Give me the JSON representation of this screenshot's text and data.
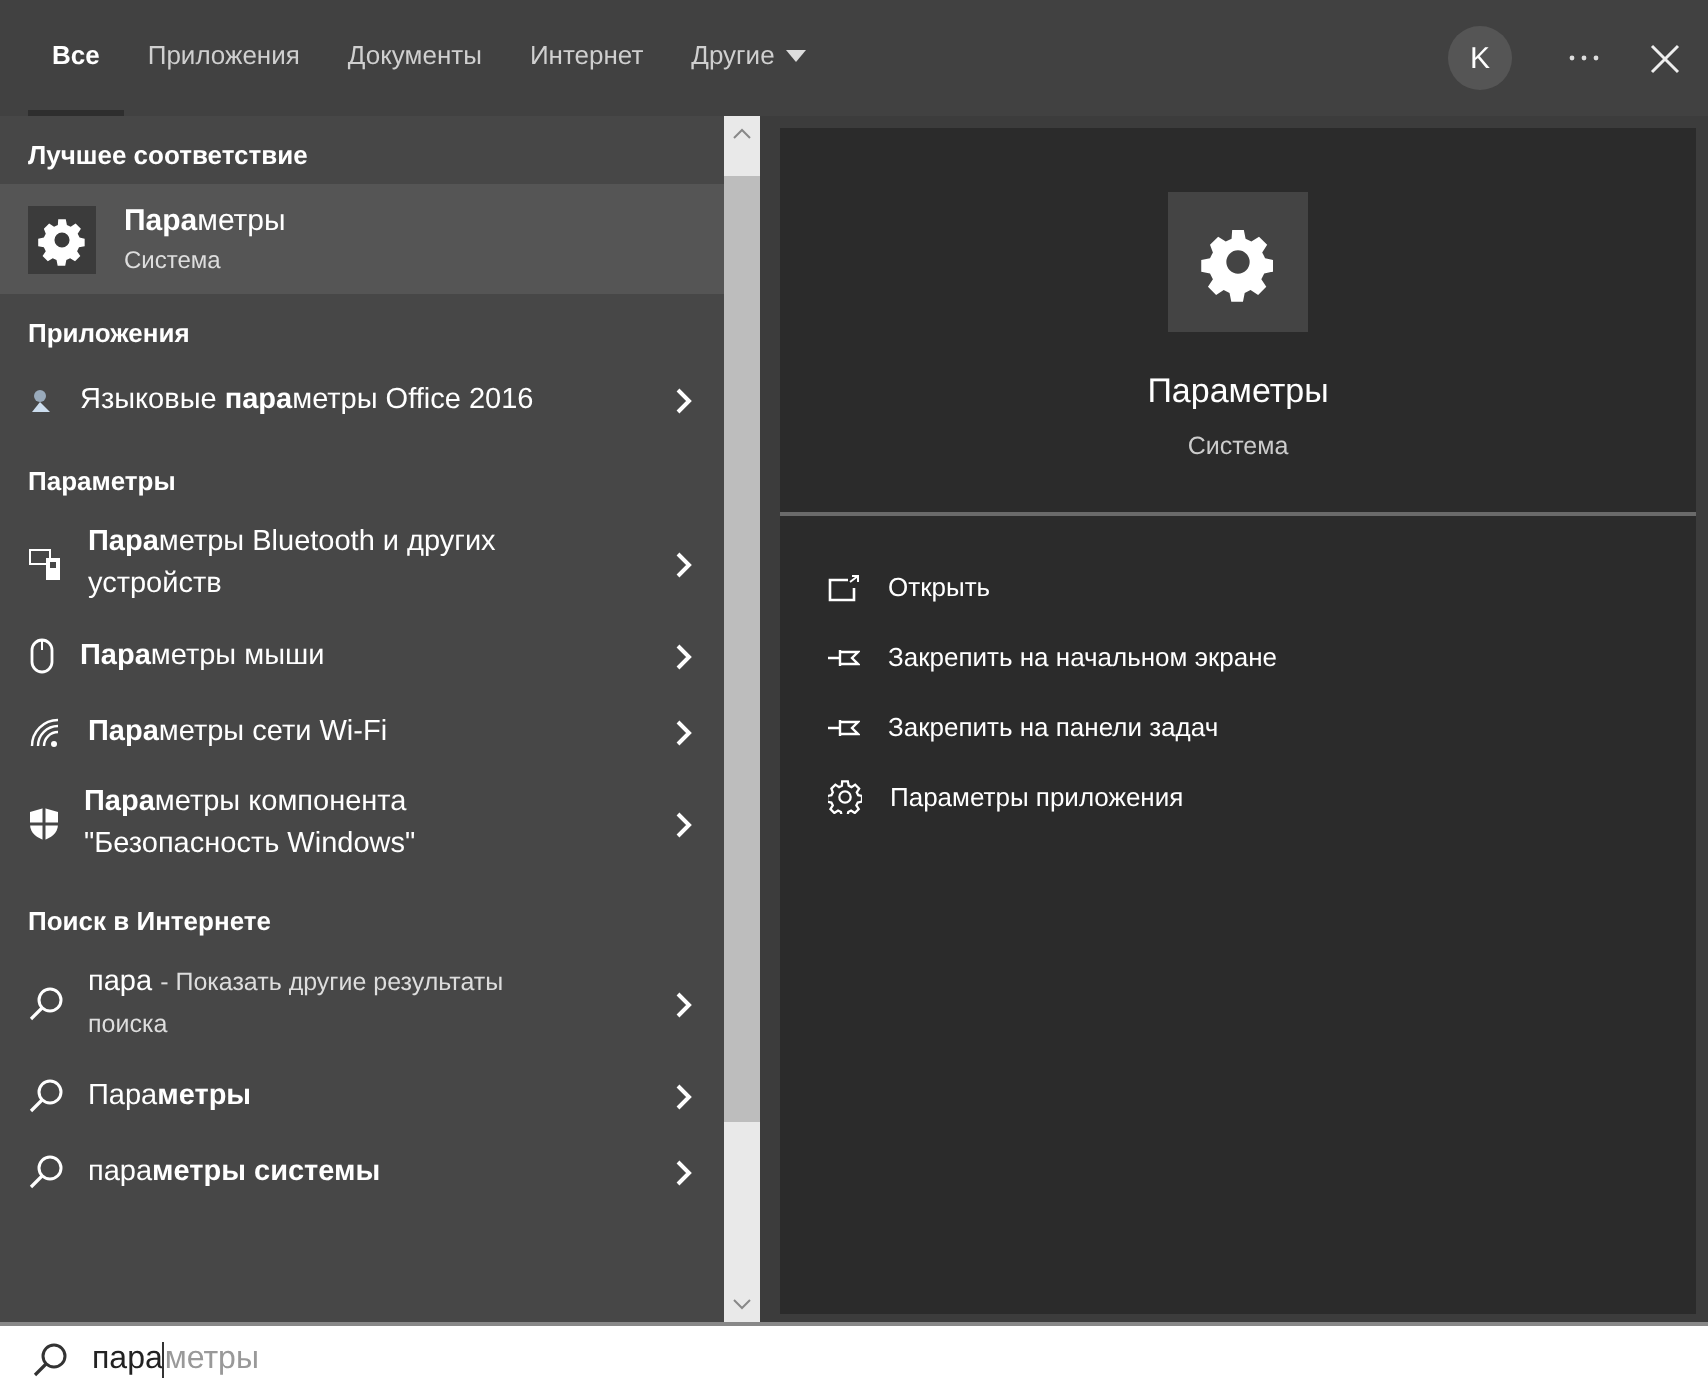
{
  "tabs": [
    {
      "label": "Все",
      "selected": true
    },
    {
      "label": "Приложения",
      "selected": false
    },
    {
      "label": "Документы",
      "selected": false
    },
    {
      "label": "Интернет",
      "selected": false
    },
    {
      "label": "Другие",
      "selected": false,
      "dropdown": true
    }
  ],
  "account": {
    "initial": "K"
  },
  "best_match": {
    "heading": "Лучшее соответствие",
    "title": "**Пара**метры",
    "subtitle": "Система",
    "selected": true
  },
  "sections": [
    {
      "heading": "Приложения",
      "items": [
        {
          "title": "Языковые **пара**метры Office 2016"
        }
      ]
    },
    {
      "heading": "Параметры",
      "items": [
        {
          "title": "**Пара**метры Bluetooth и других устройств"
        },
        {
          "title": "**Пара**метры мыши"
        },
        {
          "title": "**Пара**метры сети Wi-Fi"
        },
        {
          "title": "**Пара**метры компонента \"Безопасность Windows\""
        }
      ]
    },
    {
      "heading": "Поиск в Интернете",
      "items": [
        {
          "title": "пара",
          "detail": "- Показать другие результаты поиска"
        },
        {
          "title": "Пара**метры**"
        },
        {
          "title": "пара**метры системы**"
        }
      ]
    }
  ],
  "preview": {
    "title": "Параметры",
    "subtitle": "Система",
    "actions": [
      "Открыть",
      "Закрепить на начальном экране",
      "Закрепить на панели задач",
      "Параметры приложения"
    ]
  },
  "search": {
    "value": "пара",
    "suggestion": "метры"
  }
}
